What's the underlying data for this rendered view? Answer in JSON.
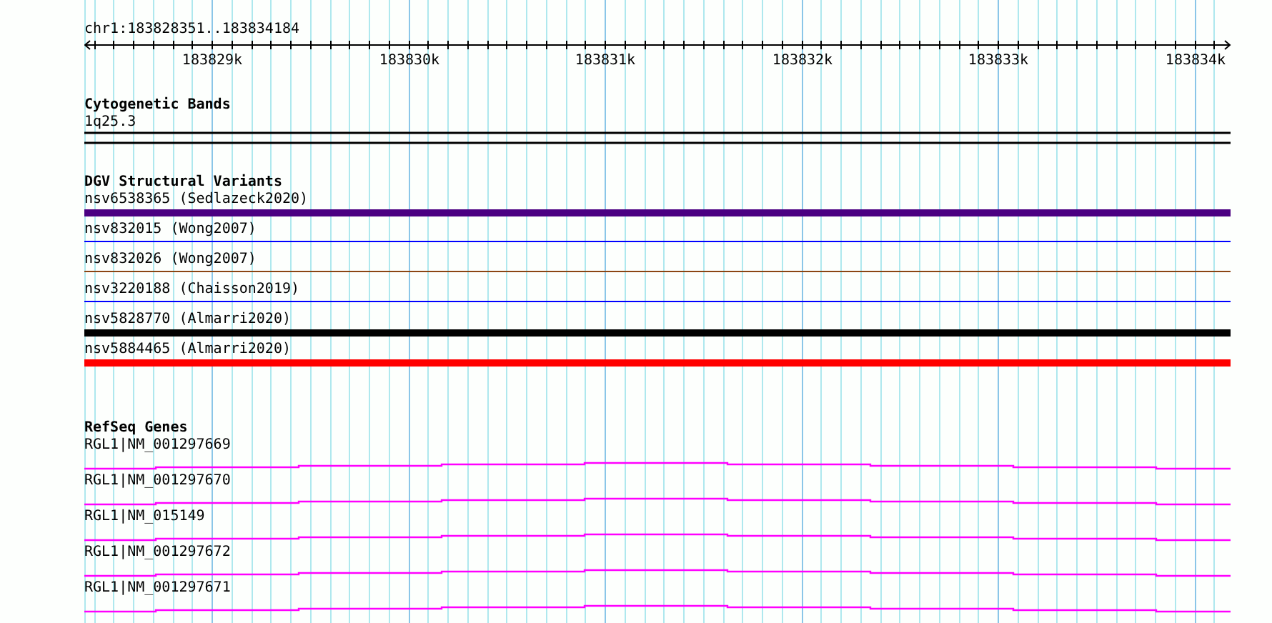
{
  "ruler": {
    "location": "chr1:183828351..183834184",
    "ticks": [
      "183829k",
      "183830k",
      "183831k",
      "183832k",
      "183833k",
      "183834k"
    ]
  },
  "tracks": [
    {
      "kind": "cytoband",
      "title": "Cytogenetic Bands",
      "features": [
        {
          "label": "1q25.3"
        }
      ]
    },
    {
      "kind": "variants",
      "title": "DGV Structural Variants",
      "features": [
        {
          "label": "nsv6538365 (Sedlazeck2020)",
          "kind": "bar",
          "color": "#4b0082"
        },
        {
          "label": "nsv832015 (Wong2007)",
          "kind": "line",
          "color": "#0000ff"
        },
        {
          "label": "nsv832026 (Wong2007)",
          "kind": "line",
          "color": "#8b4513"
        },
        {
          "label": "nsv3220188 (Chaisson2019)",
          "kind": "line",
          "color": "#0000ff"
        },
        {
          "label": "nsv5828770 (Almarri2020)",
          "kind": "bar",
          "color": "#000000"
        },
        {
          "label": "nsv5884465 (Almarri2020)",
          "kind": "bar",
          "color": "#ff0000"
        }
      ]
    },
    {
      "kind": "genes",
      "title": "RefSeq Genes",
      "features": [
        {
          "label": "RGL1|NM_001297669"
        },
        {
          "label": "RGL1|NM_001297670"
        },
        {
          "label": "RGL1|NM_015149"
        },
        {
          "label": "RGL1|NM_001297672"
        },
        {
          "label": "RGL1|NM_001297671"
        }
      ]
    }
  ]
}
